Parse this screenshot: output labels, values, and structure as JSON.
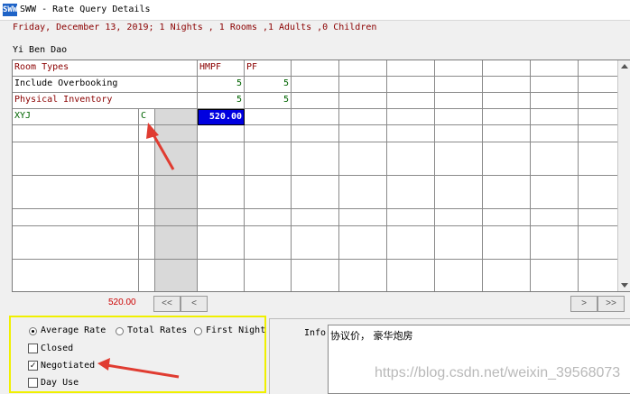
{
  "window": {
    "title": "SWW - Rate Query Details",
    "icon_text": "SWW"
  },
  "query": {
    "date_line": "Friday, December 13, 2019; 1 Nights , 1 Rooms ,1 Adults ,0 Children",
    "guest": "Yi Ben Dao"
  },
  "grid": {
    "header_label": "Room Types",
    "col1": "HMPF",
    "col2": "PF",
    "rows": [
      {
        "label": "Include Overbooking",
        "v1": "5",
        "v2": "5"
      },
      {
        "label": "Physical Inventory",
        "v1": "5",
        "v2": "5"
      }
    ],
    "rate_row": {
      "code": "XYJ",
      "type": "C",
      "amount": "520.00"
    }
  },
  "nav": {
    "total": "520.00",
    "first": "<<",
    "prev": "<",
    "next": ">",
    "last": ">>"
  },
  "options": {
    "avg_rate": "Average Rate",
    "total_rates": "Total Rates",
    "first_night": "First Night",
    "closed": "Closed",
    "negotiated": "Negotiated",
    "day_use": "Day Use",
    "selected_rate_mode": "Average Rate",
    "negotiated_checked": true
  },
  "info": {
    "label": "Info",
    "text": "协议价， 豪华炮房"
  },
  "watermark": "https://blog.csdn.net/weixin_39568073",
  "colors": {
    "header_red": "#8b0000",
    "value_green": "#006400",
    "selected_blue": "#0000e0",
    "arrow_red": "#e03c31"
  }
}
